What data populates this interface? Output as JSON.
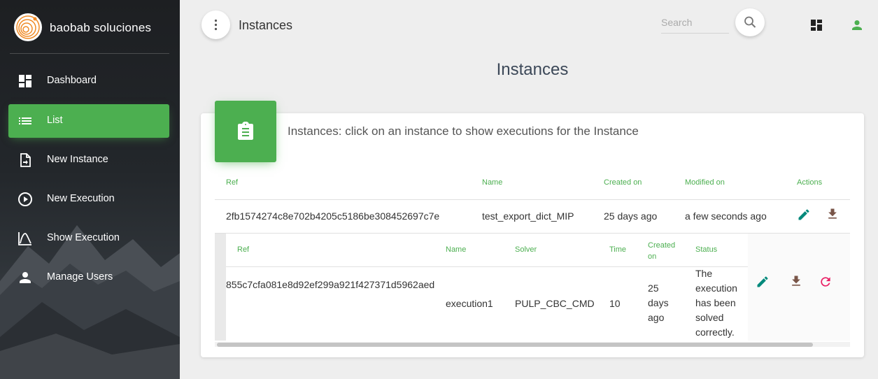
{
  "sidebar": {
    "brand": "baobab soluciones",
    "items": [
      {
        "label": "Dashboard",
        "icon": "dashboard-icon"
      },
      {
        "label": "List",
        "icon": "list-icon",
        "active": true
      },
      {
        "label": "New Instance",
        "icon": "new-file-icon"
      },
      {
        "label": "New Execution",
        "icon": "play-circle-icon"
      },
      {
        "label": "Show Execution",
        "icon": "chart-line-icon"
      },
      {
        "label": "Manage Users",
        "icon": "person-icon"
      }
    ]
  },
  "topbar": {
    "title": "Instances",
    "search_placeholder": "Search"
  },
  "page": {
    "title": "Instances"
  },
  "card": {
    "title": "Instances: click on an instance to show executions for the Instance",
    "columns": [
      "Ref",
      "Name",
      "Created on",
      "Modified on",
      "Actions"
    ],
    "rows": [
      {
        "ref": "2fb1574274c8e702b4205c5186be308452697c7e",
        "name": "test_export_dict_MIP",
        "created": "25 days ago",
        "modified": "a few seconds ago"
      }
    ],
    "executions": {
      "columns": [
        "Ref",
        "Name",
        "Solver",
        "Time",
        "Created on",
        "Status"
      ],
      "created_col": [
        "Created",
        "on"
      ],
      "rows": [
        {
          "ref": "855c7cfa081e8d92ef299a921f427371d5962aed",
          "name": "execution1",
          "solver": "PULP_CBC_CMD",
          "time": "10",
          "created_lines": [
            "25",
            "days",
            "ago"
          ],
          "status_lines": [
            "The",
            "execution",
            "has been",
            "solved",
            "correctly."
          ]
        }
      ]
    }
  },
  "colors": {
    "accent": "#4caf50",
    "edit": "#00897b",
    "download": "#795548",
    "refresh": "#e91e63"
  }
}
